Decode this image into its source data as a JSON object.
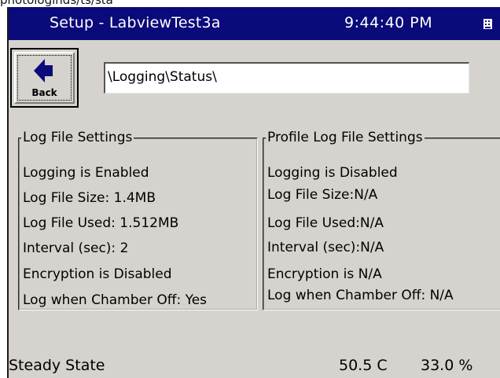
{
  "clipped_text": "photologinds/ts/sta",
  "titlebar": {
    "title": "Setup - LabviewTest3a",
    "clock": "9:44:40 PM"
  },
  "back_button": {
    "label": "Back",
    "icon": "arrow-left-icon"
  },
  "path_field": {
    "value": "\\Logging\\Status\\"
  },
  "log_file_settings": {
    "heading": "Log File Settings",
    "rows": [
      "Logging is Enabled",
      "Log File Size: 1.4MB",
      "Log File Used: 1.512MB",
      "Interval (sec): 2",
      "Encryption is Disabled",
      "Log when Chamber Off: Yes"
    ]
  },
  "profile_log_file_settings": {
    "heading": "Profile Log File Settings",
    "rows": [
      "Logging is Disabled",
      "Log File Size:N/A",
      "Log File Used:N/A",
      "Interval (sec):N/A",
      "Encryption is N/A",
      "Log when Chamber Off: N/A"
    ]
  },
  "status_bar": {
    "state": "Steady State",
    "temperature": "50.5 C",
    "humidity": "33.0 %"
  },
  "colors": {
    "titlebar": "#0a0a7a",
    "panel": "#d6d3ce"
  }
}
